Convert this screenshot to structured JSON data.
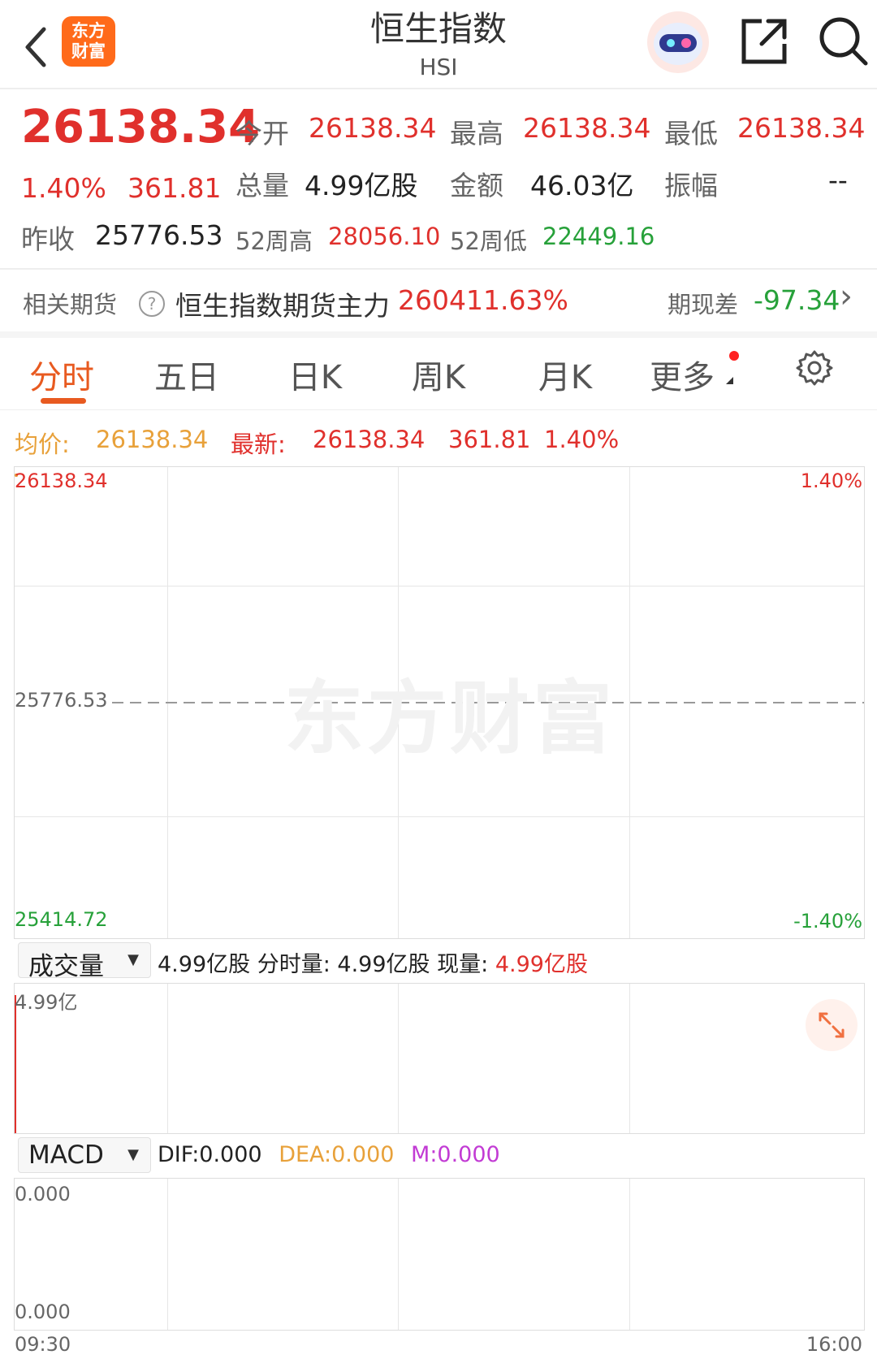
{
  "header": {
    "logo_text": "东方\n财富",
    "title": "恒生指数",
    "subtitle": "HSI"
  },
  "quote": {
    "price": "26138.34",
    "change_pct": "1.40%",
    "change_amt": "361.81",
    "prev_close_label": "昨收",
    "prev_close": "25776.53",
    "open_label": "今开",
    "open": "26138.34",
    "high_label": "最高",
    "high": "26138.34",
    "low_label": "最低",
    "low": "26138.34",
    "volume_label": "总量",
    "volume": "4.99亿股",
    "amount_label": "金额",
    "amount": "46.03亿",
    "amplitude_label": "振幅",
    "amplitude": "--",
    "w52_high_label": "52周高",
    "w52_high": "28056.10",
    "w52_low_label": "52周低",
    "w52_low": "22449.16"
  },
  "futures": {
    "label": "相关期货",
    "help": "?",
    "name": "恒生指数期货主力",
    "value": "260411.63%",
    "basis_label": "期现差",
    "basis": "-97.34",
    "chevron": "›"
  },
  "tabs": {
    "t1": "分时",
    "t2": "五日",
    "t3": "日K",
    "t4": "周K",
    "t5": "月K",
    "t6": "更多"
  },
  "chart_info": {
    "avg_label": "均价:",
    "avg": "26138.34",
    "latest_label": "最新:",
    "latest": "26138.34",
    "chg": "361.81",
    "pct": "1.40%"
  },
  "price_chart": {
    "y_top": "26138.34",
    "y_mid": "25776.53",
    "y_bottom": "25414.72",
    "pct_top": "1.40%",
    "pct_bottom": "-1.40%",
    "watermark": "东方财富"
  },
  "volume": {
    "select": "成交量",
    "arrow": "▼",
    "total": "4.99亿股",
    "period_label": "分时量:",
    "period": "4.99亿股",
    "now_label": "现量:",
    "now": "4.99亿股",
    "y_top": "4.99亿"
  },
  "macd": {
    "select": "MACD",
    "arrow": "▼",
    "dif": "DIF:0.000",
    "dea": "DEA:0.000",
    "m": "M:0.000",
    "y_top": "0.000",
    "y_bottom": "0.000",
    "time_start": "09:30",
    "time_end": "16:00"
  },
  "colors": {
    "up": "#e0302c",
    "down": "#27a13a",
    "avg": "#e8a13a",
    "accent": "#e85a20",
    "macd_m": "#c23bd4"
  },
  "chart_data": {
    "type": "line",
    "title": "",
    "x": [
      "09:30"
    ],
    "series": [
      {
        "name": "最新",
        "values": [
          26138.34
        ]
      },
      {
        "name": "均价",
        "values": [
          26138.34
        ]
      }
    ],
    "ylim": [
      25414.72,
      26138.34
    ],
    "baseline": 25776.53,
    "volume": [
      4.99
    ],
    "x_range": [
      "09:30",
      "16:00"
    ]
  }
}
